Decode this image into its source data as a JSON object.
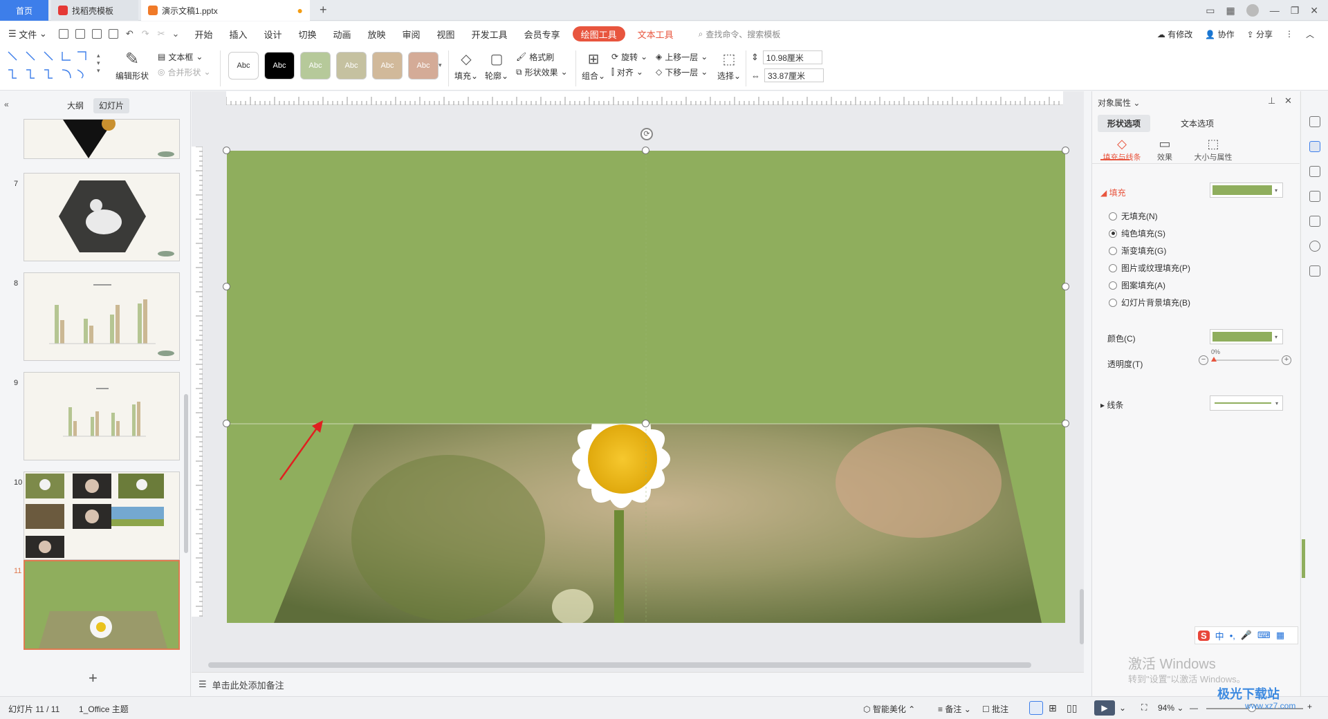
{
  "titlebar": {
    "home_tab": "首页",
    "tab1": "找稻壳模板",
    "tab2": "演示文稿1.pptx",
    "new_tab": "+"
  },
  "menubar": {
    "file": "文件",
    "items": [
      "开始",
      "插入",
      "设计",
      "切换",
      "动画",
      "放映",
      "审阅",
      "视图",
      "开发工具",
      "会员专享"
    ],
    "drawing_tool": "绘图工具",
    "text_tool": "文本工具",
    "search_placeholder": "查找命令、搜索模板",
    "right": [
      "有修改",
      "协作",
      "分享"
    ]
  },
  "ribbon": {
    "edit_shape": "编辑形状",
    "textbox": "文本框",
    "merge_shape": "合并形状",
    "style_swatches": [
      {
        "label": "Abc",
        "bg": "#ffffff",
        "fg": "#333333"
      },
      {
        "label": "Abc",
        "bg": "#000000",
        "fg": "#ffffff"
      },
      {
        "label": "Abc",
        "bg": "#b6c99a",
        "fg": "#ffffff"
      },
      {
        "label": "Abc",
        "bg": "#c5c1a0",
        "fg": "#ffffff"
      },
      {
        "label": "Abc",
        "bg": "#d1b99a",
        "fg": "#ffffff"
      },
      {
        "label": "Abc",
        "bg": "#d4ab97",
        "fg": "#ffffff"
      }
    ],
    "fill": "填充",
    "outline": "轮廓",
    "format_painter": "格式刷",
    "shape_effect": "形状效果",
    "group": "组合",
    "rotate": "旋转",
    "align": "对齐",
    "bring_forward": "上移一层",
    "send_backward": "下移一层",
    "select": "选择",
    "height": "10.98厘米",
    "width": "33.87厘米"
  },
  "leftpanel": {
    "tab_outline": "大纲",
    "tab_slides": "幻灯片",
    "slide_numbers": [
      "7",
      "8",
      "9",
      "10",
      "11"
    ],
    "add": "+"
  },
  "notes": {
    "placeholder": "单击此处添加备注"
  },
  "rightpanel": {
    "title": "对象属性",
    "tab_shape": "形状选项",
    "tab_text": "文本选项",
    "sub_fill_line": "填充与线条",
    "sub_effect": "效果",
    "sub_size": "大小与属性",
    "fill_header": "填充",
    "fill_options": [
      "无填充(N)",
      "纯色填充(S)",
      "渐变填充(G)",
      "图片或纹理填充(P)",
      "图案填充(A)",
      "幻灯片背景填充(B)"
    ],
    "selected_fill": 1,
    "color_label": "颜色(C)",
    "transparency_label": "透明度(T)",
    "transparency_value": "0%",
    "line_header": "线条",
    "fill_color": "#8fae5d"
  },
  "statusbar": {
    "slide_info": "幻灯片 11 / 11",
    "theme": "1_Office 主题",
    "beautify": "智能美化",
    "notes": "备注",
    "comments": "批注",
    "zoom": "94%"
  },
  "watermark": {
    "activate": "激活 Windows",
    "activate_sub": "转到\"设置\"以激活 Windows。",
    "site": "极光下载站",
    "site_url": "www.xz7.com"
  },
  "ime": {
    "label": "中"
  }
}
